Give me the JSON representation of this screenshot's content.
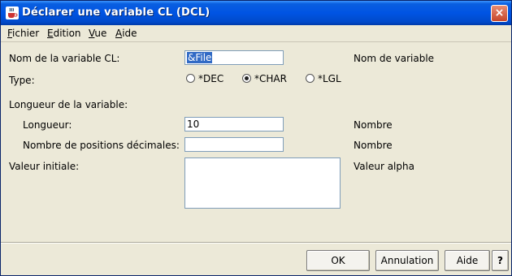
{
  "window": {
    "title": "Déclarer une variable CL (DCL)",
    "close_glyph": "×"
  },
  "menu": {
    "fichier": {
      "first": "F",
      "rest": "ichier"
    },
    "edition": {
      "first": "E",
      "rest": "dition"
    },
    "vue": {
      "first": "V",
      "rest": "ue"
    },
    "aide": {
      "first": "A",
      "rest": "ide"
    }
  },
  "form": {
    "var_name_label": "Nom de la variable CL:",
    "var_name_value": "&File",
    "var_name_hint": "Nom de variable",
    "type_label": "Type:",
    "type_options": [
      {
        "label": "*DEC",
        "selected": false
      },
      {
        "label": "*CHAR",
        "selected": true
      },
      {
        "label": "*LGL",
        "selected": false
      }
    ],
    "length_section_label": "Longueur de la variable:",
    "length_label": "Longueur:",
    "length_value": "10",
    "length_hint": "Nombre",
    "decimals_label": "Nombre de positions décimales:",
    "decimals_value": "",
    "decimals_hint": "Nombre",
    "initial_label": "Valeur initiale:",
    "initial_value": "",
    "initial_hint": "Valeur alpha"
  },
  "buttons": {
    "ok": "OK",
    "cancel": "Annulation",
    "help": "Aide",
    "question": "?"
  },
  "colors": {
    "titlebar": "#0054e3",
    "selection": "#316ac5",
    "window_bg": "#ece9d8"
  }
}
